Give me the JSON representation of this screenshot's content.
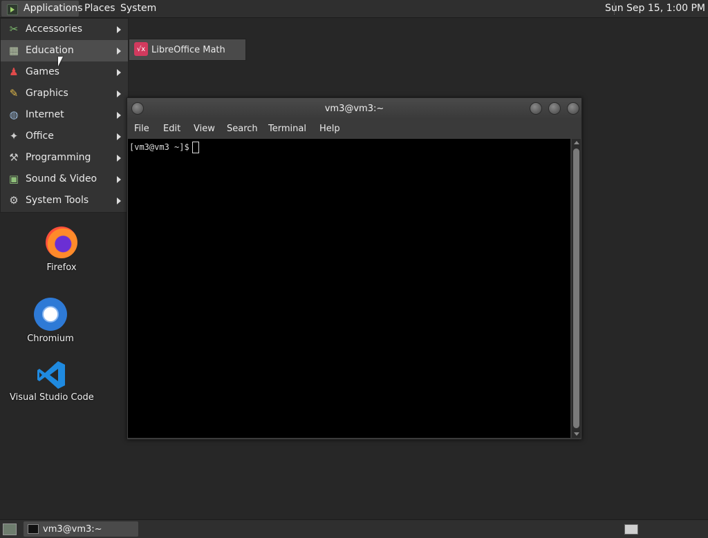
{
  "topbar": {
    "applications": "Applications",
    "places": "Places",
    "system": "System",
    "clock": "Sun Sep 15,  1:00 PM"
  },
  "menu": {
    "items": [
      {
        "label": "Accessories",
        "icon": "accessories-icon"
      },
      {
        "label": "Education",
        "icon": "education-icon"
      },
      {
        "label": "Games",
        "icon": "games-icon"
      },
      {
        "label": "Graphics",
        "icon": "graphics-icon"
      },
      {
        "label": "Internet",
        "icon": "internet-icon"
      },
      {
        "label": "Office",
        "icon": "office-icon"
      },
      {
        "label": "Programming",
        "icon": "programming-icon"
      },
      {
        "label": "Sound & Video",
        "icon": "sound-video-icon"
      },
      {
        "label": "System Tools",
        "icon": "system-tools-icon"
      }
    ],
    "active_item": "Education"
  },
  "submenu": {
    "item": "LibreOffice Math",
    "icon_glyph": "√x"
  },
  "desktop": {
    "icons": [
      {
        "label": "Firefox"
      },
      {
        "label": "Chromium"
      },
      {
        "label": "Visual Studio Code"
      }
    ]
  },
  "terminal": {
    "title": "vm3@vm3:~",
    "menu": [
      "File",
      "Edit",
      "View",
      "Search",
      "Terminal",
      "Help"
    ],
    "prompt": "[vm3@vm3 ~]$"
  },
  "taskbar": {
    "task_label": "vm3@vm3:~"
  }
}
